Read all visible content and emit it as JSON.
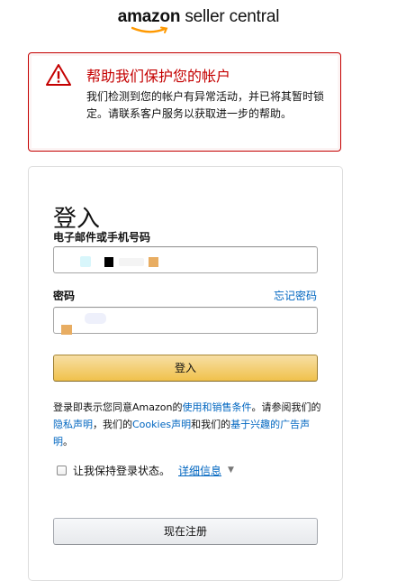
{
  "logo": {
    "brand": "amazon",
    "product": "seller central"
  },
  "alert": {
    "title": "帮助我们保护您的帐户",
    "body": "我们检测到您的帐户有异常活动，并已将其暂时锁定。请联系客户服务以获取进一步的帮助。",
    "icon": "warning-triangle-icon",
    "color": "#c40000"
  },
  "form": {
    "title": "登入",
    "email_label": "电子邮件或手机号码",
    "password_label": "密码",
    "forgot_password": "忘记密码",
    "submit_label": "登入",
    "legal": {
      "prefix": "登录即表示您同意Amazon的",
      "terms_link": "使用和销售条件",
      "middle1": "。请参阅我们的",
      "privacy_link": "隐私声明",
      "middle2": "，我们的",
      "cookies_link": "Cookies声明",
      "middle3": "和我们的",
      "interest_link": "基于兴趣的广告声明",
      "suffix": "。"
    },
    "keep_signed_in": "让我保持登录状态。",
    "details_link": "详细信息",
    "register_label": "现在注册"
  },
  "colors": {
    "link": "#0066c0",
    "primary_button": "#f0c14b",
    "alert_border": "#c40000"
  }
}
